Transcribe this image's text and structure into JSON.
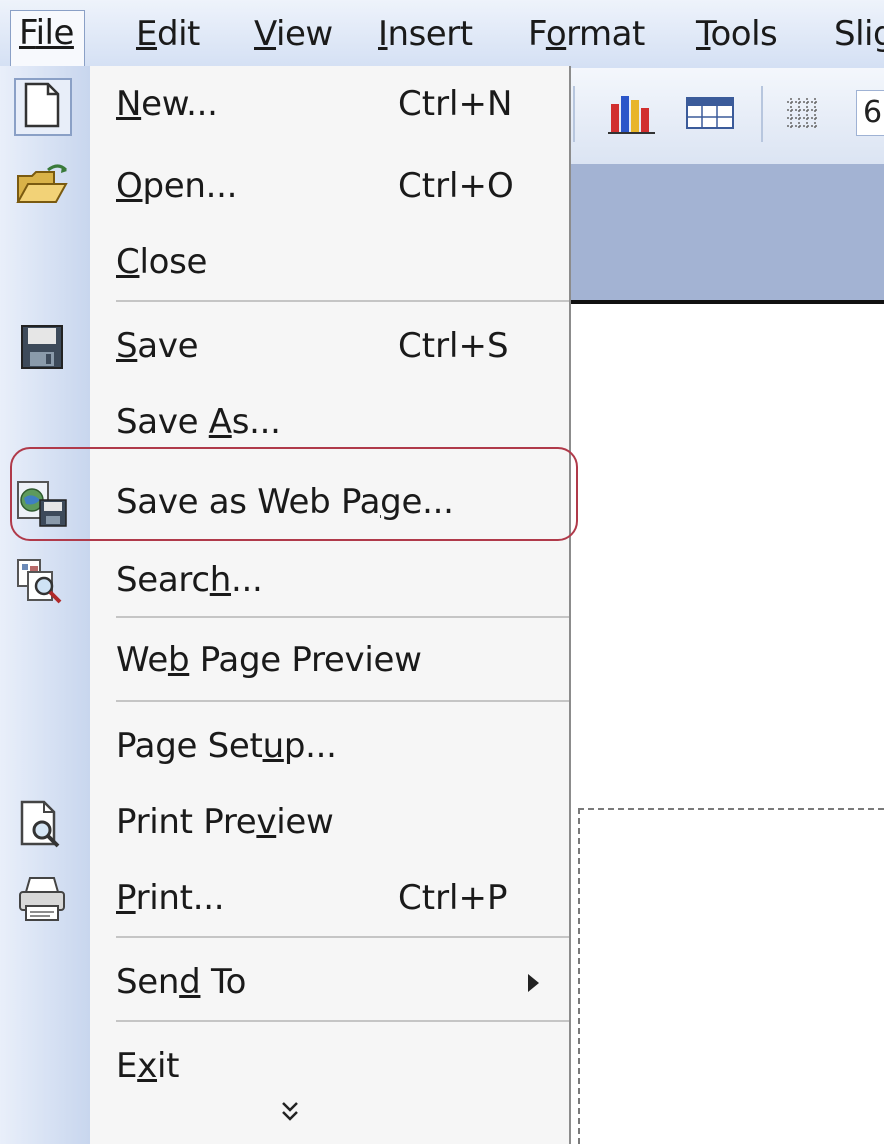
{
  "menubar": {
    "items": [
      {
        "label": "File",
        "mnemonic_index": 0
      },
      {
        "label": "Edit",
        "mnemonic_index": 0
      },
      {
        "label": "View",
        "mnemonic_index": 0
      },
      {
        "label": "Insert",
        "mnemonic_index": 0
      },
      {
        "label": "Format",
        "mnemonic_index": 1
      },
      {
        "label": "Tools",
        "mnemonic_index": 0
      },
      {
        "label": "Slig",
        "mnemonic_index": -1
      }
    ]
  },
  "toolbar": {
    "icons": [
      "chart-icon",
      "table-icon",
      "grid-icon"
    ],
    "zoom_field_value": "6"
  },
  "file_menu": {
    "items": [
      {
        "label": "New...",
        "shortcut": "Ctrl+N",
        "icon": "new-document-icon"
      },
      {
        "label": "Open...",
        "shortcut": "Ctrl+O",
        "icon": "open-folder-icon"
      },
      {
        "label": "Close",
        "shortcut": "",
        "icon": ""
      },
      {
        "label": "Save",
        "shortcut": "Ctrl+S",
        "icon": "save-disk-icon"
      },
      {
        "label": "Save As...",
        "shortcut": "",
        "icon": ""
      },
      {
        "label": "Save as Web Page...",
        "shortcut": "",
        "icon": "save-web-page-icon"
      },
      {
        "label": "Search...",
        "shortcut": "",
        "icon": "search-file-icon"
      },
      {
        "label": "Web Page Preview",
        "shortcut": "",
        "icon": ""
      },
      {
        "label": "Page Setup...",
        "shortcut": "",
        "icon": ""
      },
      {
        "label": "Print Preview",
        "shortcut": "",
        "icon": "print-preview-icon"
      },
      {
        "label": "Print...",
        "shortcut": "Ctrl+P",
        "icon": "printer-icon"
      },
      {
        "label": "Send To",
        "shortcut": "",
        "icon": "",
        "submenu": true
      },
      {
        "label": "Exit",
        "shortcut": "",
        "icon": ""
      }
    ],
    "expand_glyph": "»",
    "highlighted_item": "Save as Web Page..."
  },
  "colors": {
    "highlight_ring": "#b03a4a",
    "menu_gutter": "#c8d6ee",
    "pane_strip": "#a3b3d3"
  }
}
